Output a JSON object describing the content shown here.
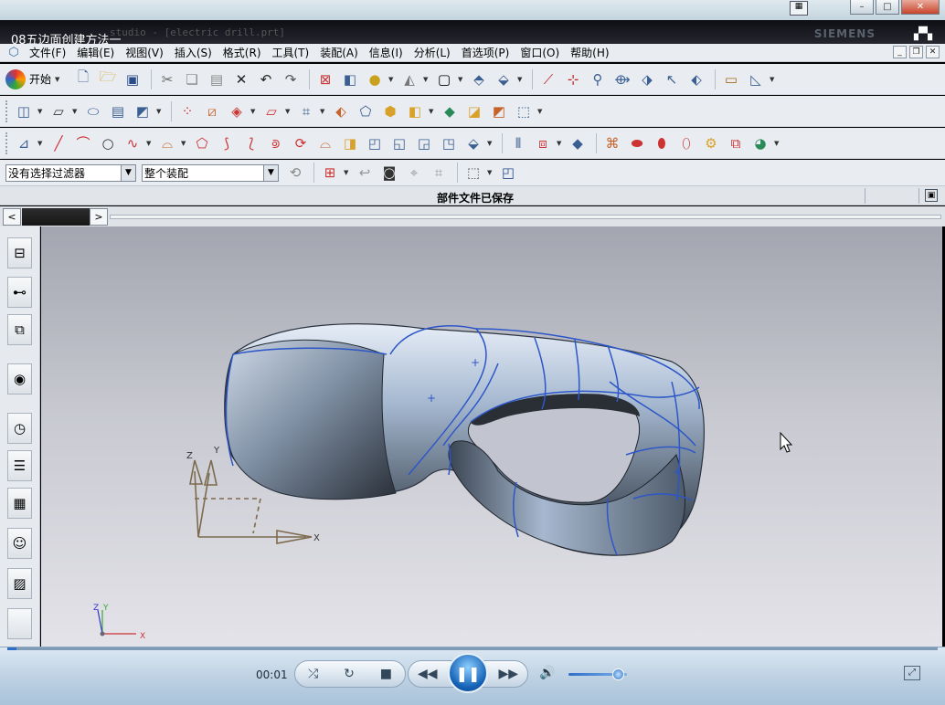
{
  "player": {
    "video_title": "08五边面创建方法一",
    "time": "00:01",
    "volume_fraction": 0.85,
    "seek_fraction": 0.01
  },
  "nx": {
    "ghost_title": "studio - [electric drill.prt]",
    "brand": "SIEMENS"
  },
  "menu": [
    "文件(F)",
    "编辑(E)",
    "视图(V)",
    "插入(S)",
    "格式(R)",
    "工具(T)",
    "装配(A)",
    "信息(I)",
    "分析(L)",
    "首选项(P)",
    "窗口(O)",
    "帮助(H)"
  ],
  "toolbar": {
    "start_label": "开始"
  },
  "selection": {
    "filter_value": "没有选择过滤器",
    "scope_value": "整个装配"
  },
  "status": {
    "message": "部件文件已保存"
  },
  "viewport": {
    "csys_labels": {
      "x": "X",
      "y": "Y",
      "z": "Z"
    },
    "triad_labels": {
      "x": "X",
      "y": "Y",
      "z": "Z"
    }
  },
  "colors": {
    "accent": "#2e6ec5",
    "edge": "#2d56c8",
    "model": "#9eb0c8"
  }
}
